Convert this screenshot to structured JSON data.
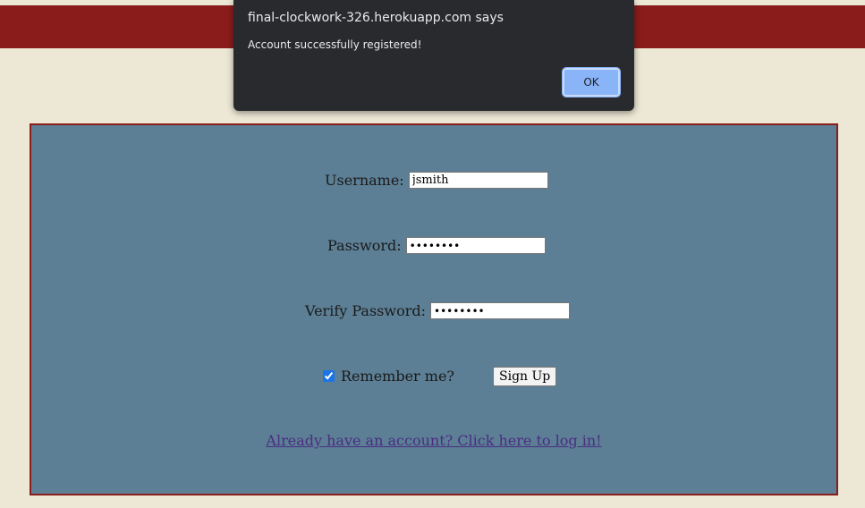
{
  "dialog": {
    "title": "final-clockwork-326.herokuapp.com says",
    "message": "Account successfully registered!",
    "ok_label": "OK"
  },
  "form": {
    "username_label": "Username:",
    "username_value": "jsmith",
    "password_label": "Password:",
    "password_value": "••••••••",
    "verify_label": "Verify Password:",
    "verify_value": "••••••••",
    "remember_label": "Remember me?",
    "remember_checked": true,
    "signup_label": "Sign Up",
    "login_link": "Already have an account? Click here to log in!"
  },
  "colors": {
    "background": "#ede8d6",
    "header": "#8b1c1c",
    "panel": "#5c7f95",
    "link": "#4a2d82",
    "dialog_bg": "#292a2d",
    "ok_button": "#8ab4f8"
  }
}
